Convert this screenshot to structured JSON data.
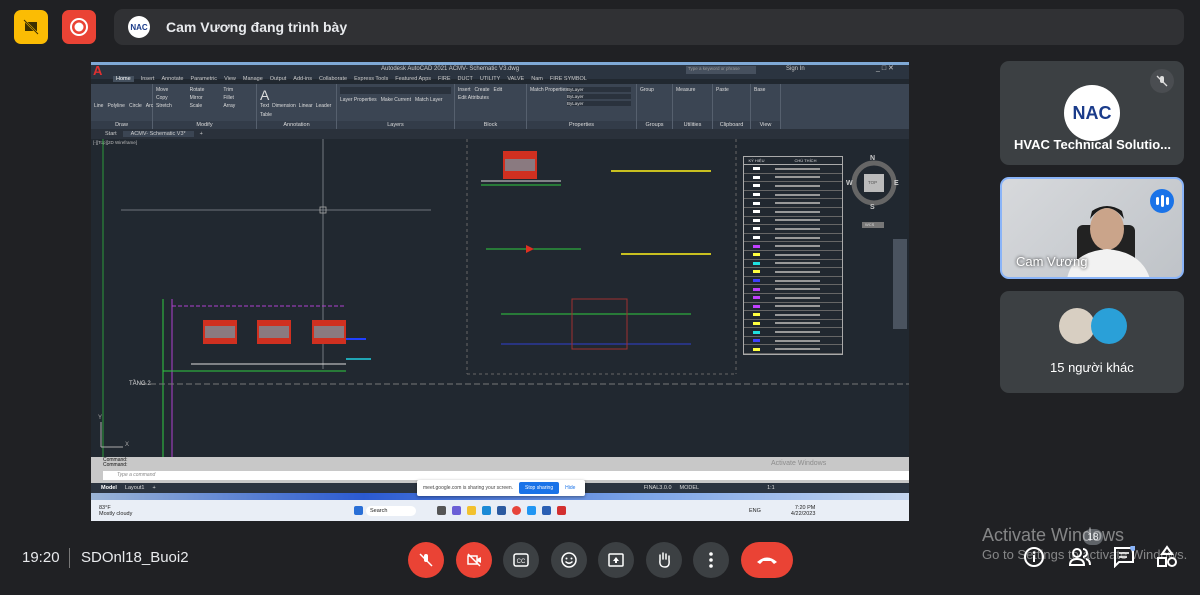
{
  "presenter_banner": {
    "text": "Cam Vương đang trình bày",
    "logo_text": "NAC"
  },
  "autocad": {
    "title": "Autodesk AutoCAD 2021   ACMV- Schematic V3.dwg",
    "search_placeholder": "Type a keyword or phrase",
    "sign_in": "Sign In",
    "ribbon_tabs": [
      "Home",
      "Insert",
      "Annotate",
      "Parametric",
      "View",
      "Manage",
      "Output",
      "Add-ins",
      "Collaborate",
      "Express Tools",
      "Featured Apps",
      "FIRE",
      "DUCT",
      "UTILITY",
      "VALVE",
      "Nam",
      "FIRE SYMBOL"
    ],
    "panels": [
      {
        "label": "Draw",
        "tools": [
          "Line",
          "Polyline",
          "Circle",
          "Arc"
        ]
      },
      {
        "label": "Modify",
        "tools": [
          "Move",
          "Rotate",
          "Trim",
          "Copy",
          "Mirror",
          "Fillet",
          "Stretch",
          "Scale",
          "Array"
        ]
      },
      {
        "label": "Annotation",
        "tools": [
          "Text",
          "Dimension",
          "Linear",
          "Leader",
          "Table"
        ]
      },
      {
        "label": "Layers",
        "tools": [
          "Layer Properties",
          "Make Current",
          "Match Layer"
        ]
      },
      {
        "label": "Block",
        "tools": [
          "Insert",
          "Create",
          "Edit",
          "Edit Attributes"
        ]
      },
      {
        "label": "Properties",
        "tools": [
          "Match Properties",
          "ByLayer",
          "ByLayer",
          "ByLayer"
        ]
      },
      {
        "label": "Groups",
        "tools": [
          "Group"
        ]
      },
      {
        "label": "Utilities",
        "tools": [
          "Measure"
        ]
      },
      {
        "label": "Clipboard",
        "tools": [
          "Paste"
        ]
      },
      {
        "label": "View",
        "tools": [
          "Base"
        ]
      }
    ],
    "doc_tabs": [
      "Start",
      "ACMV- Schematic V3*",
      "+"
    ],
    "viewport_label": "[-][Top][2D Wireframe]",
    "drawing": {
      "floor_label": "TẦNG 2",
      "viewcube": "TOP",
      "wcs": "WCS",
      "compass": {
        "n": "N",
        "s": "S",
        "e": "E",
        "w": "W"
      },
      "axis_x": "X",
      "axis_y": "Y"
    },
    "legend_header": [
      "KÝ HIỆU",
      "CHÚ THÍCH"
    ],
    "legend_colors": [
      "#ffffff",
      "#ffffff",
      "#ffffff",
      "#ffffff",
      "#ffffff",
      "#ffffff",
      "#ffffff",
      "#ffffff",
      "#ffffff",
      "#c040ff",
      "#ffff40",
      "#20e0e0",
      "#ffff40",
      "#4040ff",
      "#c040ff",
      "#c040ff",
      "#c040ff",
      "#ffff40",
      "#ffff40",
      "#20e0e0",
      "#4040ff",
      "#ffff40"
    ],
    "command_lines": [
      "Command:",
      "Command:"
    ],
    "command_placeholder": "Type a command",
    "layout_tabs": [
      "Model",
      "Layout1",
      "+"
    ],
    "status": {
      "coords": "FINAL3.0.0",
      "mode": "MODEL",
      "scale": "1:1"
    }
  },
  "share_banner": {
    "text": "meet.google.com is sharing your screen.",
    "stop": "Stop sharing",
    "hide": "Hide"
  },
  "taskbar": {
    "weather_temp": "83°F",
    "weather_desc": "Mostly cloudy",
    "search": "Search",
    "lang": "ENG",
    "time": "7:20 PM",
    "date": "4/22/2023"
  },
  "watermark_inner": "Activate Windows",
  "participants": [
    {
      "name": "HVAC Technical Solutio...",
      "logo_text": "NAC",
      "muted": true
    },
    {
      "name": "Cam Vương",
      "speaking": true
    },
    {
      "name": "15 người khác"
    }
  ],
  "bottom": {
    "time": "19:20",
    "meeting_name": "SDOnl18_Buoi2",
    "participants_count": "18"
  },
  "watermark": {
    "line1": "Activate Windows",
    "line2": "Go to Settings to activate Windows."
  },
  "colors": {
    "danger": "#ea4335",
    "tile": "#3c4043",
    "accent": "#8ab4f8",
    "autocad_bg": "#212830"
  }
}
